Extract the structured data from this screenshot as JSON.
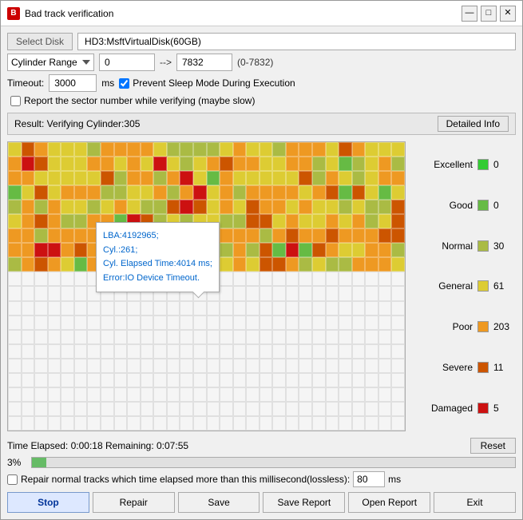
{
  "window": {
    "title": "Bad track verification",
    "icon_label": "BT"
  },
  "toolbar": {
    "select_disk_label": "Select Disk",
    "disk_name": "HD3:MsftVirtualDisk(60GB)"
  },
  "cylinder_range": {
    "dropdown_label": "Cylinder Range",
    "start": "0",
    "arrow": "-->",
    "end": "7832",
    "hint": "(0-7832)"
  },
  "timeout": {
    "label": "Timeout:",
    "value": "3000",
    "unit": "ms",
    "sleep_mode_label": "Prevent Sleep Mode During Execution",
    "sector_label": "Report the sector number while verifying (maybe slow)"
  },
  "result": {
    "text": "Result:  Verifying Cylinder:305",
    "detailed_info": "Detailed Info"
  },
  "tooltip": {
    "line1": "LBA:4192965;",
    "line2": "Cyl.:261;",
    "line3": "Cyl. Elapsed Time:4014 ms;",
    "line4": "Error:IO Device Timeout."
  },
  "legend": {
    "items": [
      {
        "label": "Excellent",
        "color": "#33cc33",
        "count": "0"
      },
      {
        "label": "Good",
        "color": "#66bb44",
        "count": "0"
      },
      {
        "label": "Normal",
        "color": "#aabb44",
        "count": "30"
      },
      {
        "label": "General",
        "color": "#ddcc33",
        "count": "61"
      },
      {
        "label": "Poor",
        "color": "#ee9922",
        "count": "203"
      },
      {
        "label": "Severe",
        "color": "#cc5500",
        "count": "11"
      },
      {
        "label": "Damaged",
        "color": "#cc1111",
        "count": "5"
      }
    ]
  },
  "time": {
    "elapsed_label": "Time Elapsed:",
    "elapsed_value": "0:00:18",
    "remaining_label": "Remaining:",
    "remaining_value": "0:07:55",
    "reset_label": "Reset"
  },
  "progress": {
    "percent": "3%",
    "fill_width": "3"
  },
  "repair": {
    "label": "Repair normal tracks which time elapsed more than this millisecond(lossless):",
    "value": "80",
    "unit": "ms"
  },
  "buttons": {
    "stop": "Stop",
    "repair": "Repair",
    "save": "Save",
    "save_report": "Save Report",
    "open_report": "Open Report",
    "exit": "Exit"
  },
  "colors": {
    "excellent": "#33cc33",
    "good": "#66bb44",
    "normal": "#aabb44",
    "general": "#ddcc33",
    "poor": "#ee9922",
    "severe": "#cc5500",
    "damaged": "#cc1111",
    "empty": "#f0f0f0"
  }
}
